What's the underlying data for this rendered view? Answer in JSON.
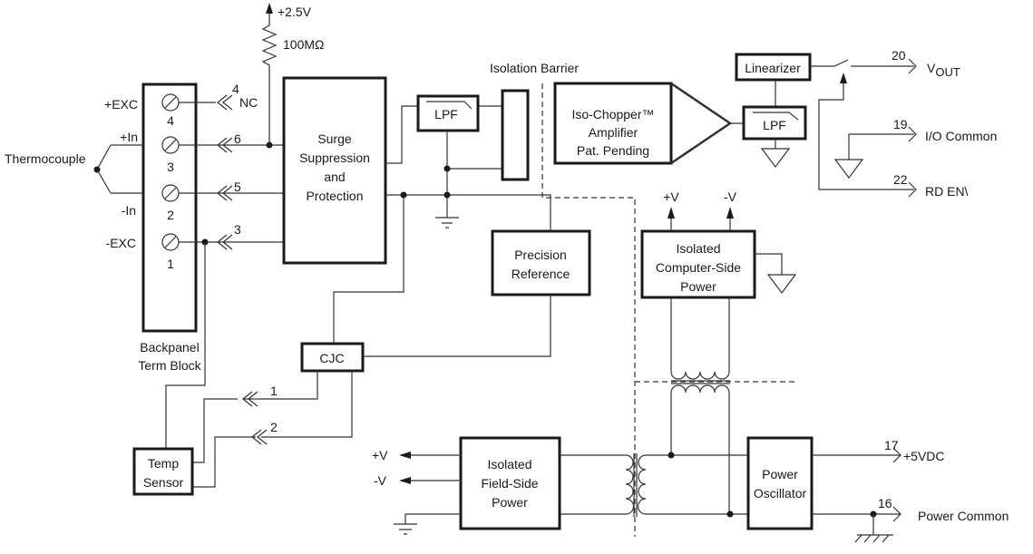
{
  "terminal_block": {
    "label_line1": "Backpanel",
    "label_line2": "Term Block",
    "terminals": [
      {
        "signal": "+EXC",
        "number": "4"
      },
      {
        "signal": "+In",
        "number": "3"
      },
      {
        "signal": "-In",
        "number": "2"
      },
      {
        "signal": "-EXC",
        "number": "1"
      }
    ]
  },
  "thermocouple": "Thermocouple",
  "connector_pins": {
    "nc_pin": "4",
    "nc_label": "NC",
    "in_plus": "6",
    "in_minus": "5",
    "exc_minus": "3"
  },
  "bias": {
    "supply": "+2.5V",
    "resistor": "100MΩ"
  },
  "surge": [
    "Surge",
    "Suppression",
    "and",
    "Protection"
  ],
  "lpf_input": "LPF",
  "isolation_barrier": "Isolation Barrier",
  "amplifier": [
    "Iso-Chopper™",
    "Amplifier",
    "Pat. Pending"
  ],
  "lpf_output": "LPF",
  "linearizer": "Linearizer",
  "outputs": [
    {
      "pin": "20",
      "label": "V",
      "sub": "OUT"
    },
    {
      "pin": "19",
      "label": "I/O Common"
    },
    {
      "pin": "22",
      "label": "RD EN\\"
    }
  ],
  "precision_reference": [
    "Precision",
    "Reference"
  ],
  "cjc": "CJC",
  "cjc_pins": [
    "1",
    "2"
  ],
  "temp_sensor": [
    "Temp",
    "Sensor"
  ],
  "computer_power": {
    "lines": [
      "Isolated",
      "Computer-Side",
      "Power"
    ],
    "plus": "+V",
    "minus": "-V"
  },
  "field_power": {
    "lines": [
      "Isolated",
      "Field-Side",
      "Power"
    ],
    "plus": "+V",
    "minus": "-V"
  },
  "power_oscillator": [
    "Power",
    "Oscillator"
  ],
  "power_pins": [
    {
      "pin": "17",
      "label": "+5VDC"
    },
    {
      "pin": "16",
      "label": "Power Common"
    }
  ]
}
